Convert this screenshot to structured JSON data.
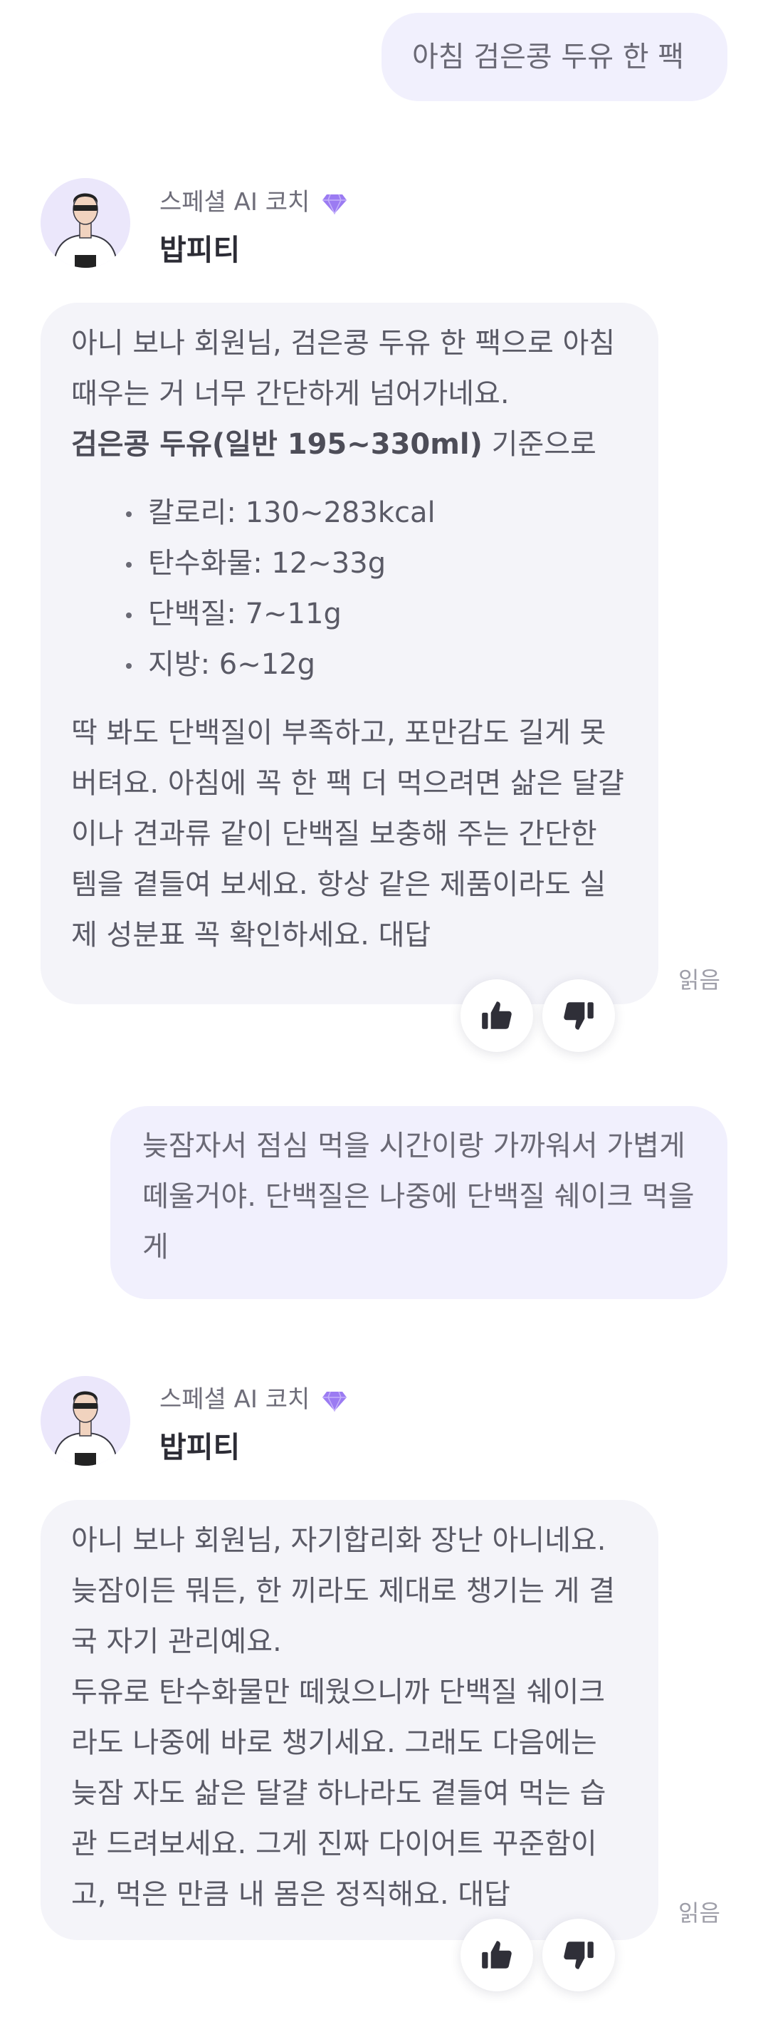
{
  "messages": [
    {
      "role": "user",
      "text": "아침 검은콩 두유 한 팩"
    },
    {
      "role": "coach",
      "coach_label": "스페셜 AI 코치",
      "coach_name": "밥피티",
      "intro": "아니 보나 회원님, 검은콩 두유 한 팩으로 아침 때우는 거 너무 간단하게 넘어가네요.",
      "basis_bold": "검은콩 두유(일반 195~330ml)",
      "basis_rest": " 기준으로",
      "nutrition": [
        "칼로리: 130~283kcal",
        "탄수화물: 12~33g",
        "단백질: 7~11g",
        "지방: 6~12g"
      ],
      "outro": "딱 봐도 단백질이 부족하고, 포만감도 길게 못 버텨요. 아침에 꼭 한 팩 더 먹으려면 삶은 달걀이나 견과류 같이 단백질 보충해 주는 간단한 템을 곁들여 보세요. 항상 같은 제품이라도 실제 성분표 꼭 확인하세요. 대답",
      "read_label": "읽음"
    },
    {
      "role": "user",
      "text": "늦잠자서 점심 먹을 시간이랑 가까워서 가볍게 떼울거야. 단백질은 나중에 단백질 쉐이크 먹을게"
    },
    {
      "role": "coach",
      "coach_label": "스페셜 AI 코치",
      "coach_name": "밥피티",
      "para1": "아니 보나 회원님, 자기합리화 장난 아니네요. 늦잠이든 뭐든, 한 끼라도 제대로 챙기는 게 결국 자기 관리예요.",
      "para2": "두유로 탄수화물만 떼웠으니까 단백질 쉐이크라도 나중에 바로 챙기세요. 그래도 다음에는 늦잠 자도 삶은 달걀 하나라도 곁들여 먹는 습관 드려보세요. 그게 진짜 다이어트 꾸준함이고, 먹은 만큼 내 몸은 정직해요. 대답",
      "read_label": "읽음"
    }
  ],
  "colors": {
    "user_bubble": "#f1f0fd",
    "coach_bubble": "#f4f4f9",
    "accent_gem": "#9b7bf2",
    "name_text": "#2c2c35"
  },
  "icons": [
    "coach-avatar",
    "gem-icon",
    "thumbs-up-icon",
    "thumbs-down-icon"
  ]
}
